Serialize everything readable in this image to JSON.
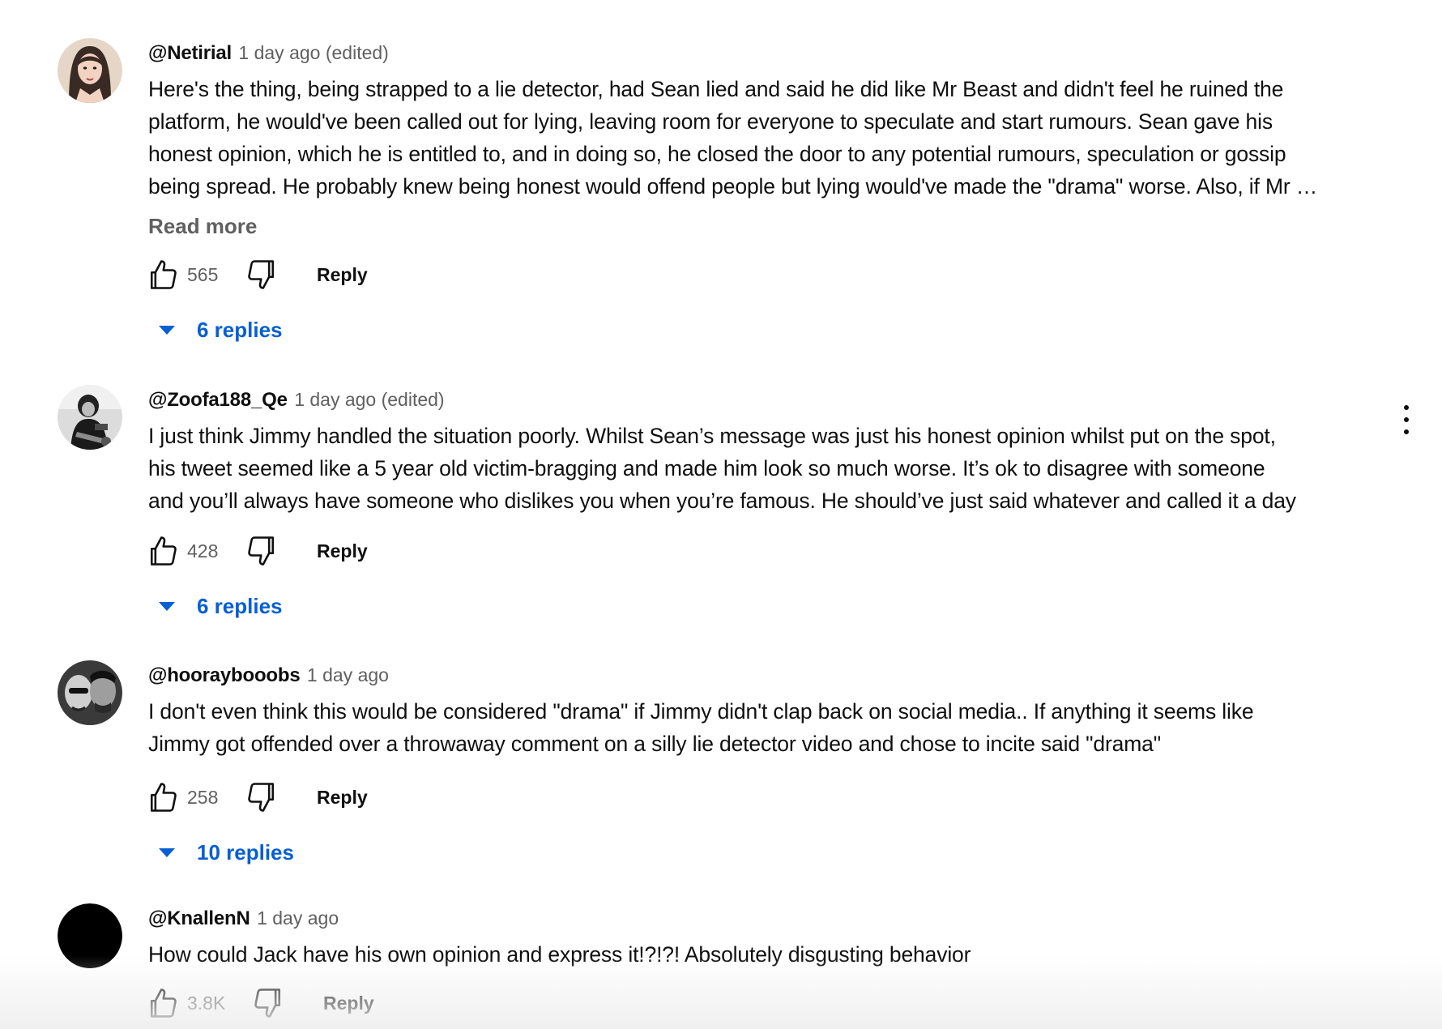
{
  "comments": [
    {
      "author": "@Netirial",
      "time": "1 day ago (edited)",
      "avatar": "woman-portrait",
      "lines": [
        "Here's the thing, being strapped to a lie detector, had Sean lied and said he did like Mr Beast and didn't feel he ruined the",
        "platform, he would've been called out for lying, leaving room for everyone to speculate and start rumours. Sean gave his",
        "honest opinion, which he is entitled to, and in doing so, he closed the door to any potential rumours, speculation or gossip",
        "being spread. He probably knew being honest would offend people but lying would've made the \"drama\" worse. Also, if Mr …"
      ],
      "read_more": "Read more",
      "likes": "565",
      "reply_label": "Reply",
      "replies_label": "6 replies"
    },
    {
      "author": "@Zoofa188_Qe",
      "time": "1 day ago (edited)",
      "avatar": "bw-musician-photo",
      "lines": [
        "I just think Jimmy handled the situation poorly. Whilst Sean’s message was just his honest opinion whilst put on the spot,",
        "his tweet seemed like a 5 year old victim-bragging and made him look so much worse. It’s ok to disagree with someone",
        "and you’ll always have someone who dislikes you when you’re famous. He should’ve just said whatever and called it a day"
      ],
      "likes": "428",
      "reply_label": "Reply",
      "replies_label": "6 replies"
    },
    {
      "author": "@hooraybooobs",
      "time": "1 day ago",
      "avatar": "bw-group-photo",
      "lines": [
        "I don't even think this would be considered \"drama\" if Jimmy didn't clap back on social media.. If anything it seems like",
        "Jimmy got offended over a throwaway comment on a silly lie detector video and chose to incite said \"drama\""
      ],
      "likes": "258",
      "reply_label": "Reply",
      "replies_label": "10 replies"
    },
    {
      "author": "@KnallenN",
      "time": "1 day ago",
      "avatar": "black-circle",
      "lines": [
        "How could Jack have his own opinion and express it!?!?! Absolutely disgusting behavior"
      ],
      "likes": "3.8K",
      "reply_label": "Reply"
    }
  ],
  "colors": {
    "text": "#0f0f0f",
    "secondary": "#606060",
    "link": "#065fd4"
  },
  "icons": {
    "like": "thumbs-up-icon",
    "dislike": "thumbs-down-icon",
    "expand": "caret-down-icon",
    "menu": "more-vert-icon"
  }
}
